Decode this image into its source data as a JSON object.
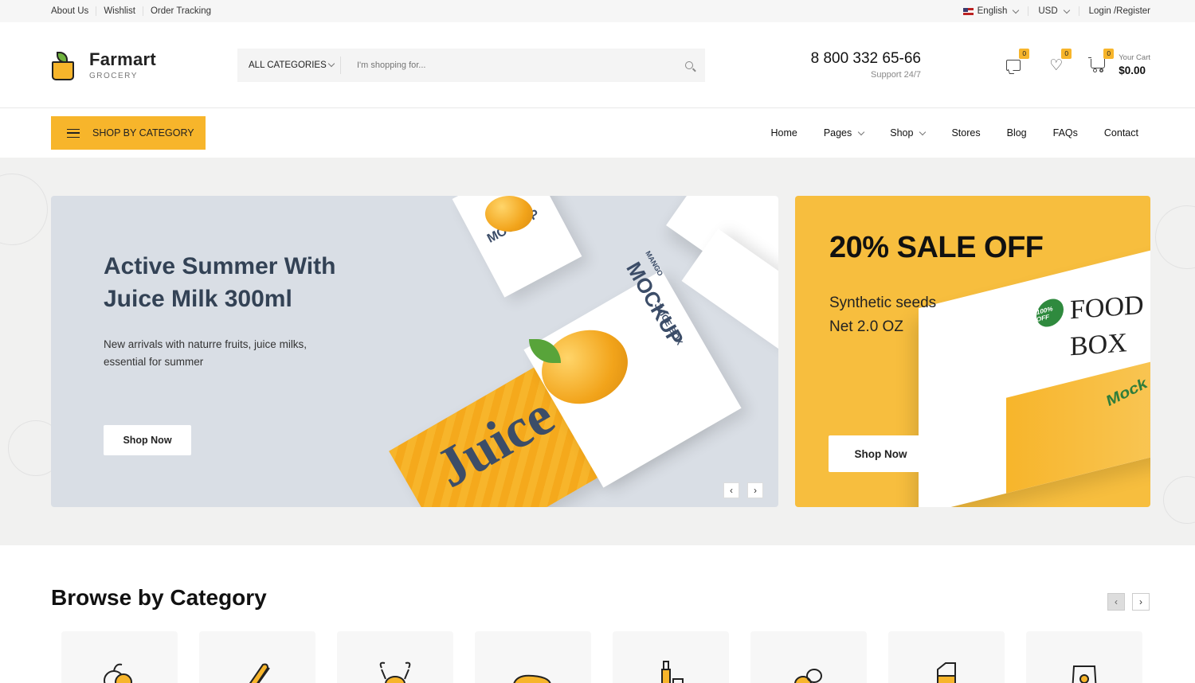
{
  "topbar": {
    "links": [
      "About Us",
      "Wishlist",
      "Order Tracking"
    ],
    "language": "English",
    "currency": "USD",
    "login": "Login /Register"
  },
  "header": {
    "logo_name": "Farmart",
    "logo_tagline": "GROCERY",
    "search": {
      "category": "ALL CATEGORIES",
      "placeholder": "I'm shopping for..."
    },
    "phone": "8 800 332 65-66",
    "support": "Support 24/7",
    "compare_count": "0",
    "wishlist_count": "0",
    "cart_count": "0",
    "cart_label": "Your Cart",
    "cart_amount": "$0.00"
  },
  "nav": {
    "shop_by_category": "SHOP BY CATEGORY",
    "items": [
      {
        "label": "Home",
        "dropdown": false
      },
      {
        "label": "Pages",
        "dropdown": true
      },
      {
        "label": "Shop",
        "dropdown": true
      },
      {
        "label": "Stores",
        "dropdown": false
      },
      {
        "label": "Blog",
        "dropdown": false
      },
      {
        "label": "FAQs",
        "dropdown": false
      },
      {
        "label": "Contact",
        "dropdown": false
      }
    ]
  },
  "hero": {
    "title": "Active Summer With Juice Milk 300ml",
    "description": "New arrivals with naturre fruits, juice milks, essential for summer",
    "button": "Shop Now",
    "artwork": {
      "box_label": "MOCKUP",
      "box_sub": "JUICE BOX",
      "flavor": "MANGO",
      "brand": "Juice"
    }
  },
  "promo": {
    "title": "20% SALE OFF",
    "line1": "Synthetic seeds",
    "line2": "Net 2.0 OZ",
    "button": "Shop Now",
    "artwork": {
      "box_text": "FOOD BOX",
      "box_mock": "Mock",
      "seal": "100% OFF"
    }
  },
  "browse": {
    "title": "Browse by Category",
    "categories": [
      "fruit-icon",
      "bread-icon",
      "seafood-icon",
      "meat-icon",
      "drinks-icon",
      "coffee-icon",
      "milk-icon",
      "pet-food-icon"
    ]
  },
  "colors": {
    "accent": "#f7b52b",
    "hero_bg": "#d9dee5",
    "heading": "#334255"
  }
}
